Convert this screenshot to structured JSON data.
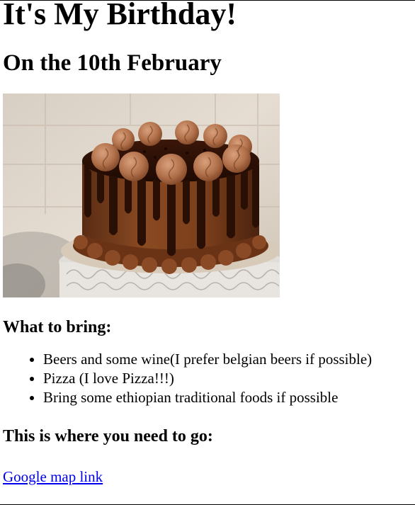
{
  "heading": "It's My Birthday!",
  "subheading": "On the 10th February",
  "bring_heading": "What to bring:",
  "bring_items": [
    "Beers and some wine(I prefer belgian beers if possible)",
    "Pizza (I love Pizza!!!)",
    "Bring some ethiopian traditional foods if possible"
  ],
  "location_heading": "This is where you need to go:",
  "map_link_text": "Google map link",
  "colors": {
    "link": "#0000EE",
    "text": "#000000",
    "background": "#ffffff"
  },
  "image": {
    "subject": "chocolate drip cake on white cake stand"
  }
}
